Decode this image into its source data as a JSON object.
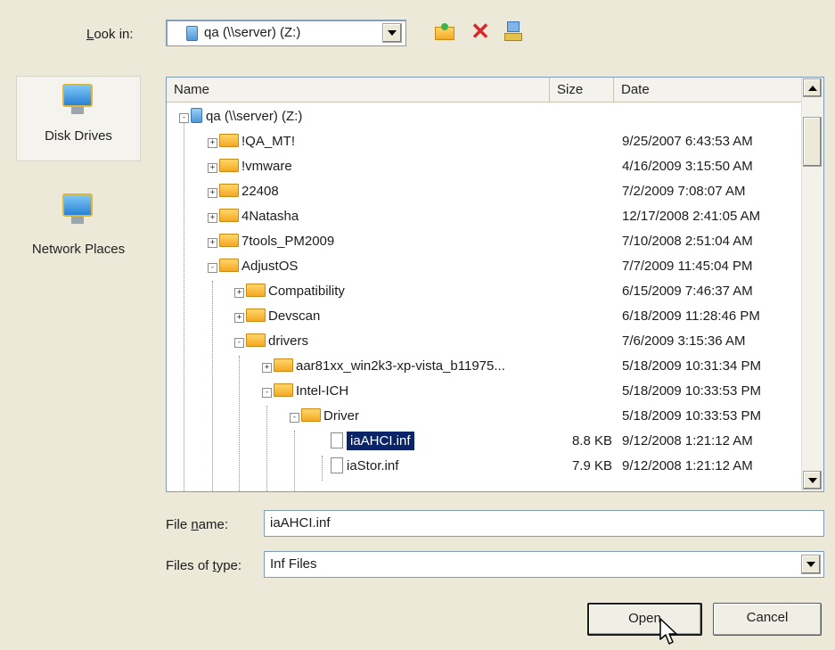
{
  "look_in": {
    "label": "Look in:",
    "value": "qa (\\\\server) (Z:)"
  },
  "places": [
    {
      "label": "Disk Drives",
      "icon": "computer-icon",
      "selected": true
    },
    {
      "label": "Network Places",
      "icon": "network-icon",
      "selected": false
    }
  ],
  "columns": {
    "name": "Name",
    "size": "Size",
    "date": "Date"
  },
  "tree": [
    {
      "name": "qa (\\\\server) (Z:)",
      "size": "",
      "date": "",
      "level": 0,
      "type": "drive",
      "expander": "-"
    },
    {
      "name": "!QA_MT!",
      "size": "",
      "date": "9/25/2007 6:43:53 AM",
      "level": 1,
      "type": "folder",
      "expander": "+"
    },
    {
      "name": "!vmware",
      "size": "",
      "date": "4/16/2009 3:15:50 AM",
      "level": 1,
      "type": "folder",
      "expander": "+"
    },
    {
      "name": "22408",
      "size": "",
      "date": "7/2/2009 7:08:07 AM",
      "level": 1,
      "type": "folder",
      "expander": "+"
    },
    {
      "name": "4Natasha",
      "size": "",
      "date": "12/17/2008 2:41:05 AM",
      "level": 1,
      "type": "folder",
      "expander": "+"
    },
    {
      "name": "7tools_PM2009",
      "size": "",
      "date": "7/10/2008 2:51:04 AM",
      "level": 1,
      "type": "folder",
      "expander": "+"
    },
    {
      "name": "AdjustOS",
      "size": "",
      "date": "7/7/2009 11:45:04 PM",
      "level": 1,
      "type": "folder",
      "expander": "-"
    },
    {
      "name": "Compatibility",
      "size": "",
      "date": "6/15/2009 7:46:37 AM",
      "level": 2,
      "type": "folder",
      "expander": "+"
    },
    {
      "name": "Devscan",
      "size": "",
      "date": "6/18/2009 11:28:46 PM",
      "level": 2,
      "type": "folder",
      "expander": "+"
    },
    {
      "name": "drivers",
      "size": "",
      "date": "7/6/2009 3:15:36 AM",
      "level": 2,
      "type": "folder",
      "expander": "-"
    },
    {
      "name": "aar81xx_win2k3-xp-vista_b11975...",
      "size": "",
      "date": "5/18/2009 10:31:34 PM",
      "level": 3,
      "type": "folder",
      "expander": "+"
    },
    {
      "name": "Intel-ICH",
      "size": "",
      "date": "5/18/2009 10:33:53 PM",
      "level": 3,
      "type": "folder",
      "expander": "-"
    },
    {
      "name": "Driver",
      "size": "",
      "date": "5/18/2009 10:33:53 PM",
      "level": 4,
      "type": "folder",
      "expander": "-"
    },
    {
      "name": "iaAHCI.inf",
      "size": "8.8 KB",
      "date": "9/12/2008 1:21:12 AM",
      "level": 5,
      "type": "file",
      "expander": "",
      "selected": true
    },
    {
      "name": "iaStor.inf",
      "size": "7.9 KB",
      "date": "9/12/2008 1:21:12 AM",
      "level": 5,
      "type": "file",
      "expander": ""
    }
  ],
  "file_name": {
    "label": "File name:",
    "value": "iaAHCI.inf"
  },
  "files_of_type": {
    "label": "Files of type:",
    "value": "Inf Files"
  },
  "buttons": {
    "open": "Open",
    "cancel": "Cancel"
  },
  "colors": {
    "selection": "#0a246a",
    "background": "#ece9d8"
  }
}
